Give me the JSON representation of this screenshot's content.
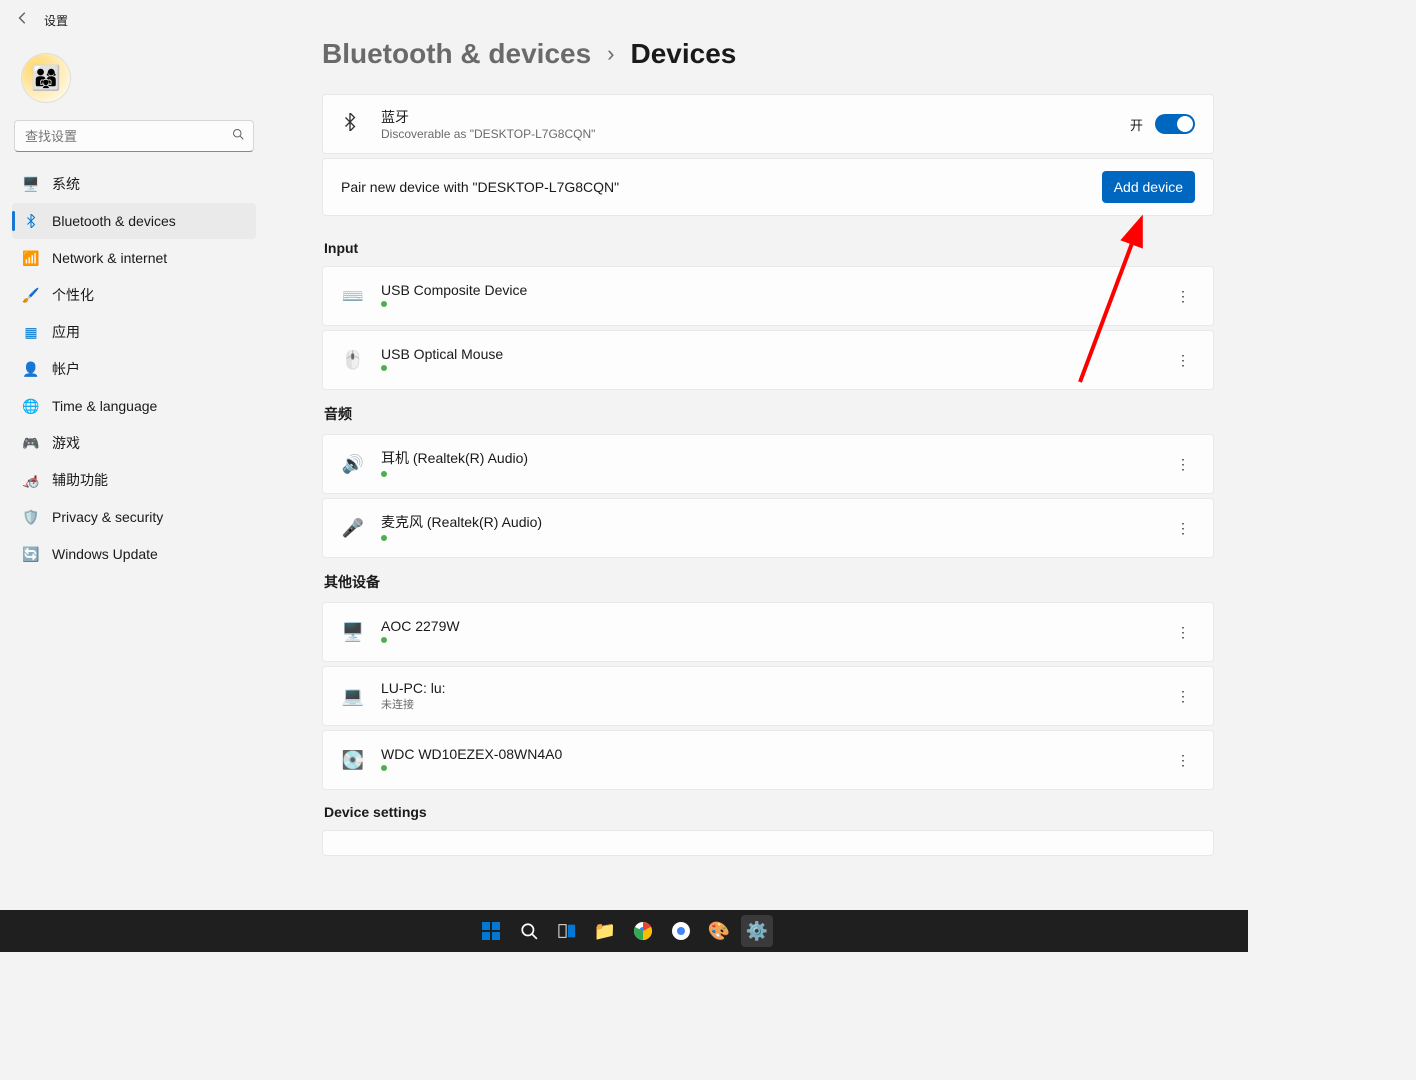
{
  "header": {
    "title": "设置"
  },
  "search": {
    "placeholder": "查找设置"
  },
  "sidebar": {
    "items": [
      {
        "label": "系统"
      },
      {
        "label": "Bluetooth & devices"
      },
      {
        "label": "Network & internet"
      },
      {
        "label": "个性化"
      },
      {
        "label": "应用"
      },
      {
        "label": "帐户"
      },
      {
        "label": "Time & language"
      },
      {
        "label": "游戏"
      },
      {
        "label": "辅助功能"
      },
      {
        "label": "Privacy & security"
      },
      {
        "label": "Windows Update"
      }
    ]
  },
  "breadcrumb": {
    "parent": "Bluetooth & devices",
    "current": "Devices"
  },
  "bluetooth": {
    "title": "蓝牙",
    "subtitle": "Discoverable as \"DESKTOP-L7G8CQN\"",
    "state_label": "开"
  },
  "pair": {
    "text": "Pair new device with \"DESKTOP-L7G8CQN\"",
    "button": "Add device"
  },
  "sections": {
    "input": {
      "title": "Input",
      "devices": [
        {
          "name": "USB Composite Device",
          "status_dot": true,
          "status_text": ""
        },
        {
          "name": "USB Optical Mouse",
          "status_dot": true,
          "status_text": ""
        }
      ]
    },
    "audio": {
      "title": "音频",
      "devices": [
        {
          "name": "耳机 (Realtek(R) Audio)",
          "status_dot": true,
          "status_text": ""
        },
        {
          "name": "麦克风 (Realtek(R) Audio)",
          "status_dot": true,
          "status_text": ""
        }
      ]
    },
    "other": {
      "title": "其他设备",
      "devices": [
        {
          "name": "AOC 2279W",
          "status_dot": true,
          "status_text": ""
        },
        {
          "name": "LU-PC: lu:",
          "status_dot": false,
          "status_text": "未连接"
        },
        {
          "name": "WDC WD10EZEX-08WN4A0",
          "status_dot": true,
          "status_text": ""
        }
      ]
    },
    "settings": {
      "title": "Device settings"
    }
  }
}
